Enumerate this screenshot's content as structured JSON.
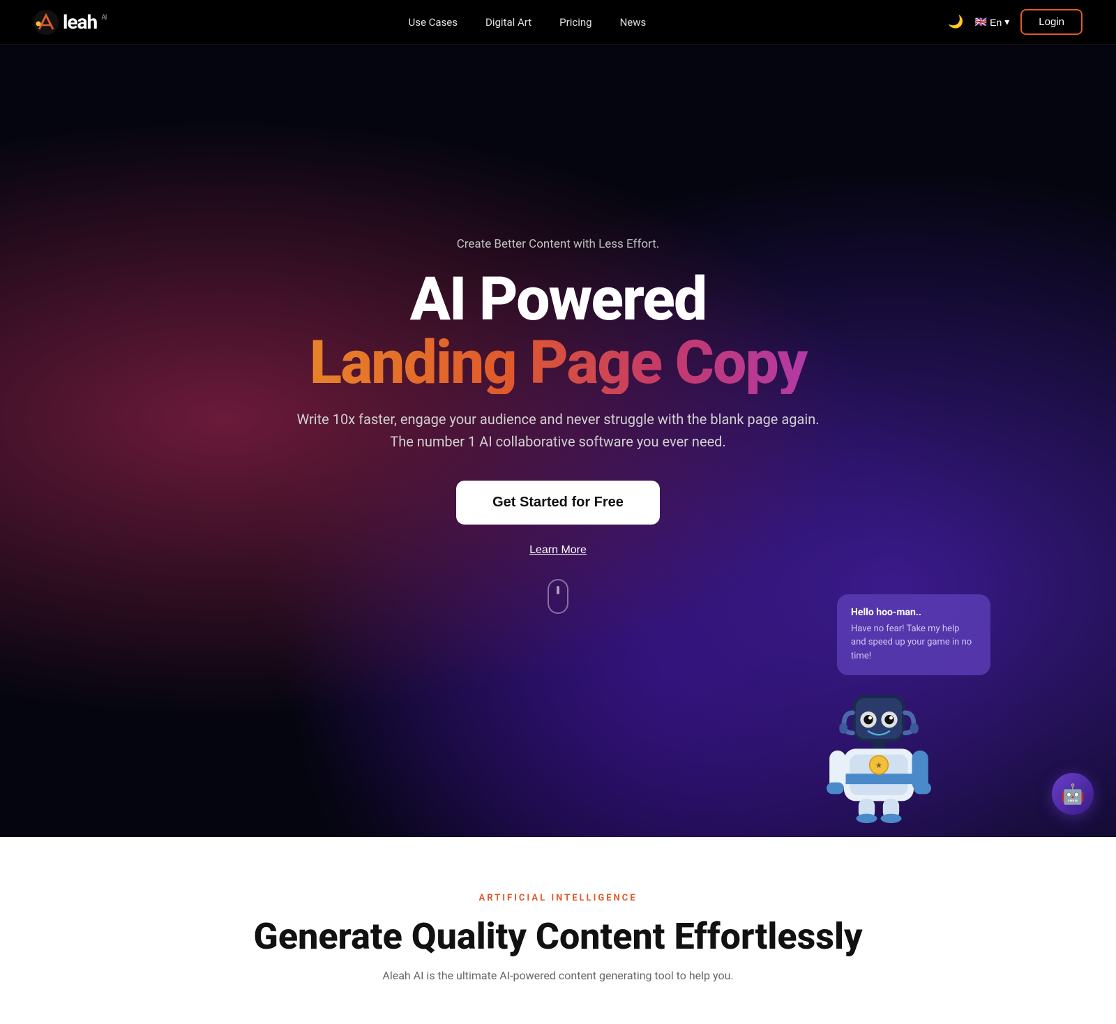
{
  "navbar": {
    "logo_text": "leah",
    "logo_ai": "AI",
    "nav_items": [
      {
        "label": "Use Cases",
        "href": "#"
      },
      {
        "label": "Digital Art",
        "href": "#"
      },
      {
        "label": "Pricing",
        "href": "#"
      },
      {
        "label": "News",
        "href": "#"
      }
    ],
    "dark_mode_icon": "🌙",
    "flag_icon": "🇬🇧",
    "lang_label": "En",
    "login_label": "Login"
  },
  "hero": {
    "tagline": "Create Better Content with Less Effort.",
    "title_white": "AI Powered",
    "title_gradient": "Landing Page Copy",
    "subtitle_line1": "Write 10x faster, engage your audience and never struggle with the blank page again.",
    "subtitle_line2": "The number 1 AI collaborative software you ever need.",
    "cta_label": "Get Started for Free",
    "learn_more_label": "Learn More"
  },
  "robot": {
    "bubble_title": "Hello hoo-man..",
    "bubble_text": "Have no fear! Take my help and speed up your game in no time!"
  },
  "lower": {
    "ai_label": "ARTIFICIAL INTELLIGENCE",
    "title": "Generate Quality Content Effortlessly",
    "subtitle": "Aleah AI is the ultimate AI-powered content generating tool to help you."
  },
  "chatbot": {
    "icon": "🤖"
  }
}
